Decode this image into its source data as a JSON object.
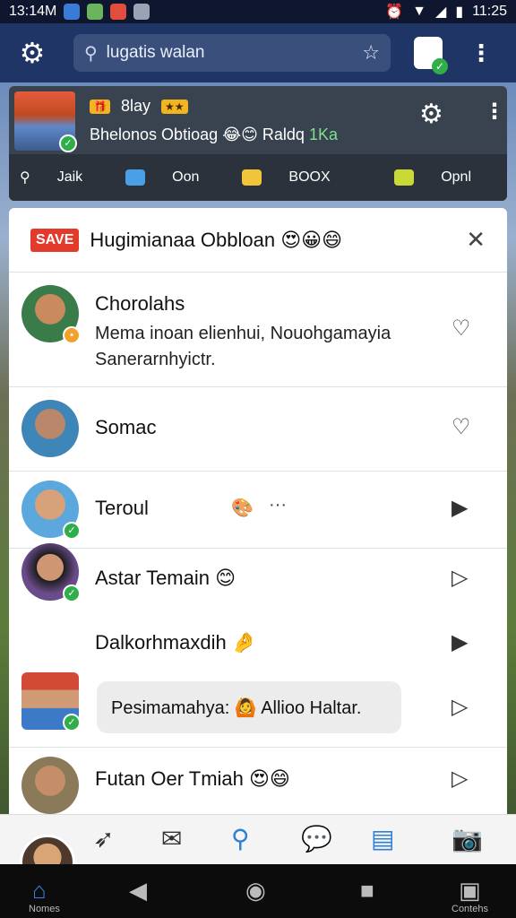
{
  "status": {
    "time_left": "13:14M",
    "time_right": "11:25"
  },
  "appbar": {
    "search_text": "lugatis walan"
  },
  "notice": {
    "tag": "8lay",
    "line2_main": "Bhelonos Obtioag 😂😊 Raldq",
    "line2_green": "1Ka",
    "bar": {
      "a": "Jaik",
      "b": "Oon",
      "c": "BOOX",
      "open": "Opnl"
    }
  },
  "panel": {
    "save_badge": "SAVE",
    "title": "Hugimianaa Obbloan 😍😀😄",
    "rows": [
      {
        "name": "Chorolahs",
        "message": "Mema inoan elienhui, Nouohgamayia Sanerarnhyictr."
      },
      {
        "name": "Somac"
      },
      {
        "name": "Teroul",
        "extra": "···"
      },
      {
        "name": "Astar Temain 😊"
      },
      {
        "name": "Dalkorhmaxdih 🤌",
        "bubble": "Pesimamahya: 🙆 Allioo Haltar."
      },
      {
        "name": "Futan Oer Tmiah 😍😄"
      }
    ]
  },
  "navbar": {
    "home_label": "Nomes",
    "contents_label": "Contehs"
  }
}
